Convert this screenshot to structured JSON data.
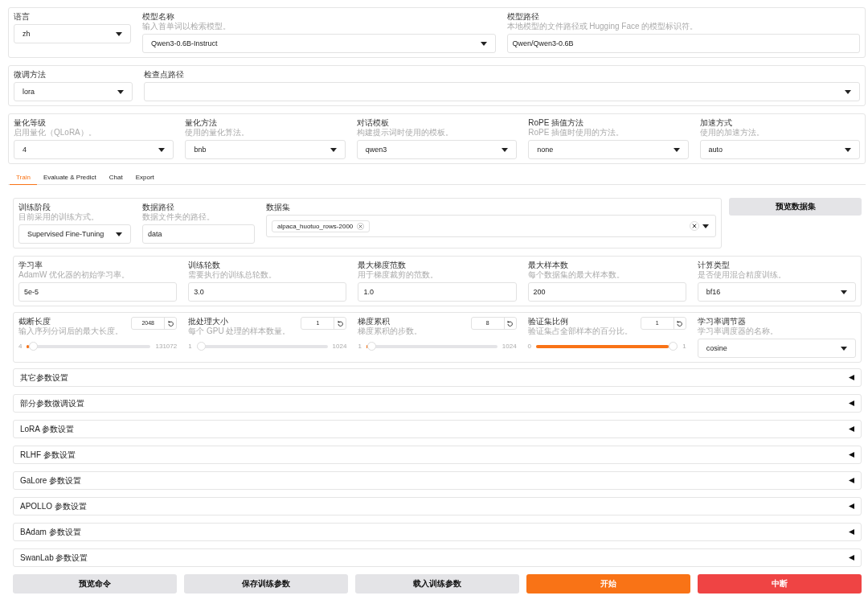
{
  "config_sections": [
    {
      "fields": [
        {
          "kind": "dropdown",
          "label": "语言",
          "value": "zh"
        },
        {
          "kind": "dropdown",
          "label": "模型名称",
          "hint": "输入首单词以检索模型。",
          "value": "Qwen3-0.6B-Instruct"
        },
        {
          "kind": "text",
          "label": "模型路径",
          "hint": "本地模型的文件路径或 Hugging Face 的模型标识符。",
          "value": "Qwen/Qwen3-0.6B"
        }
      ]
    },
    {
      "fields": [
        {
          "kind": "dropdown",
          "label": "微调方法",
          "value": "lora"
        },
        {
          "kind": "dropdown",
          "label": "检查点路径"
        }
      ]
    },
    {
      "fields": [
        {
          "kind": "dropdown",
          "label": "量化等级",
          "hint": "启用量化（QLoRA）。",
          "value": "4"
        },
        {
          "kind": "dropdown",
          "label": "量化方法",
          "hint": "使用的量化算法。",
          "value": "bnb"
        },
        {
          "kind": "dropdown",
          "label": "对话模板",
          "hint": "构建提示词时使用的模板。",
          "value": "qwen3"
        },
        {
          "kind": "dropdown",
          "label": "RoPE 插值方法",
          "hint": "RoPE 插值时使用的方法。",
          "value": "none"
        },
        {
          "kind": "dropdown",
          "label": "加速方式",
          "hint": "使用的加速方法。",
          "value": "auto"
        }
      ]
    }
  ],
  "tabs": [
    {
      "label": "Train",
      "selected": true
    },
    {
      "label": "Evaluate & Predict",
      "selected": false
    },
    {
      "label": "Chat",
      "selected": false
    },
    {
      "label": "Export",
      "selected": false
    }
  ],
  "train": {
    "dataset_section": {
      "fields": [
        {
          "kind": "dropdown",
          "label": "训练阶段",
          "hint": "目前采用的训练方式。",
          "value": "Supervised Fine-Tuning"
        },
        {
          "kind": "text",
          "label": "数据路径",
          "hint": "数据文件夹的路径。",
          "value": "data"
        },
        {
          "kind": "multiselect",
          "label": "数据集",
          "tags": [
            "alpaca_huotuo_rows-2000"
          ]
        }
      ]
    },
    "preview_button": "预览数据集",
    "sections": [
      {
        "fields": [
          {
            "kind": "text",
            "label": "学习率",
            "hint": "AdamW 优化器的初始学习率。",
            "value": "5e-5"
          },
          {
            "kind": "text",
            "label": "训练轮数",
            "hint": "需要执行的训练总轮数。",
            "value": "3.0"
          },
          {
            "kind": "text",
            "label": "最大梯度范数",
            "hint": "用于梯度裁剪的范数。",
            "value": "1.0"
          },
          {
            "kind": "text",
            "label": "最大样本数",
            "hint": "每个数据集的最大样本数。",
            "value": "200"
          },
          {
            "kind": "dropdown",
            "label": "计算类型",
            "hint": "是否使用混合精度训练。",
            "value": "bf16"
          }
        ]
      },
      {
        "fields": [
          {
            "kind": "slider",
            "label": "截断长度",
            "hint": "输入序列分词后的最大长度。",
            "value": "2048",
            "min": "4",
            "max": "131072",
            "level": 0.016
          },
          {
            "kind": "slider",
            "label": "批处理大小",
            "hint": "每个 GPU 处理的样本数量。",
            "value": "1",
            "min": "1",
            "max": "1024",
            "level": 0
          },
          {
            "kind": "slider",
            "label": "梯度累积",
            "hint": "梯度累积的步数。",
            "value": "8",
            "min": "1",
            "max": "1024",
            "level": 0.007
          },
          {
            "kind": "slider",
            "label": "验证集比例",
            "hint": "验证集占全部样本的百分比。",
            "value": "1",
            "min": "0",
            "max": "1",
            "level": 1
          },
          {
            "kind": "dropdown",
            "label": "学习率调节器",
            "hint": "学习率调度器的名称。",
            "value": "cosine"
          }
        ]
      }
    ],
    "accordions": [
      {
        "label": "其它参数设置",
        "expanded": false
      },
      {
        "label": "部分参数微调设置",
        "expanded": false
      },
      {
        "label": "LoRA 参数设置",
        "expanded": false
      },
      {
        "label": "RLHF 参数设置",
        "expanded": false
      },
      {
        "label": "GaLore 参数设置",
        "expanded": false
      },
      {
        "label": "APOLLO 参数设置",
        "expanded": false
      },
      {
        "label": "BAdam 参数设置",
        "expanded": false
      },
      {
        "label": "SwanLab 参数设置",
        "expanded": false
      }
    ],
    "actions": [
      {
        "label": "预览命令",
        "kind": "secondary"
      },
      {
        "label": "保存训练参数",
        "kind": "secondary"
      },
      {
        "label": "载入训练参数",
        "kind": "secondary"
      },
      {
        "label": "开始",
        "kind": "primary"
      },
      {
        "label": "中断",
        "kind": "stop"
      }
    ]
  }
}
